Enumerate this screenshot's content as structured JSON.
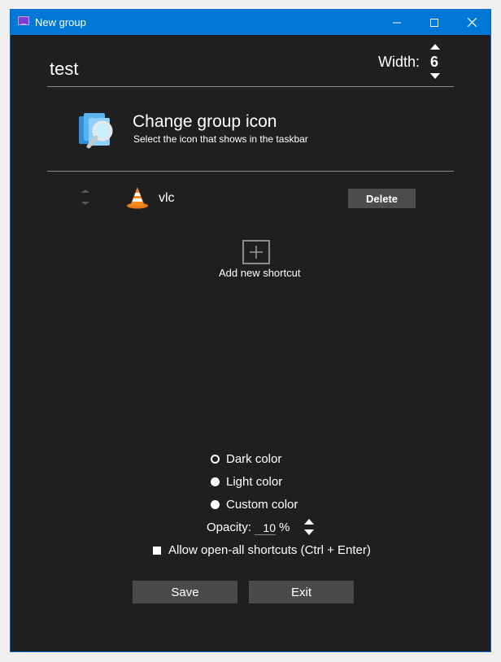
{
  "window": {
    "title": "New group"
  },
  "header": {
    "group_name": "test",
    "width_label": "Width:",
    "width_value": "6"
  },
  "icon_section": {
    "title": "Change group icon",
    "subtitle": "Select the icon that shows in the taskbar"
  },
  "shortcuts": [
    {
      "name": "vlc",
      "icon": "vlc-cone-icon",
      "delete_label": "Delete"
    }
  ],
  "add_shortcut": {
    "label": "Add new shortcut"
  },
  "colors_option": {
    "options": [
      {
        "label": "Dark color",
        "selected": true
      },
      {
        "label": "Light color",
        "selected": false
      },
      {
        "label": "Custom color",
        "selected": false
      }
    ]
  },
  "opacity": {
    "label": "Opacity:",
    "value": "10",
    "unit": "%"
  },
  "open_all": {
    "label": "Allow open-all shortcuts (Ctrl + Enter)",
    "checked": false
  },
  "footer": {
    "save_label": "Save",
    "exit_label": "Exit"
  },
  "theme": {
    "titlebar": "#0078d7",
    "background": "#1f1f1f",
    "button": "#4a4a4a"
  }
}
